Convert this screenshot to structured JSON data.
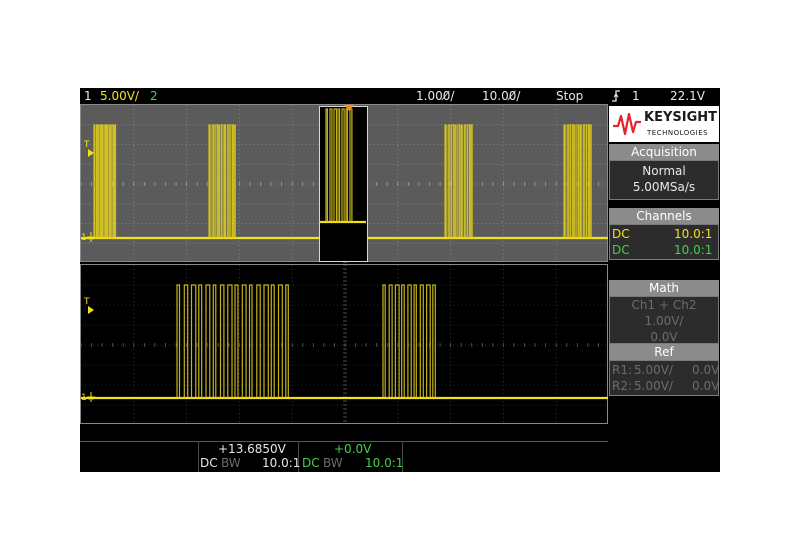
{
  "top_bar": {
    "ch1_num": "1",
    "ch1_scale": "5.00V/",
    "ch2_num": "2",
    "time_main": "1.000̸/",
    "time_zoom": "10.00̸/",
    "run_state": "Stop",
    "trigger_icon": "rising-edge-trigger-icon",
    "trigger_ch": "1",
    "trigger_level": "22.1V"
  },
  "logo": {
    "brand": "KEYSIGHT",
    "sub": "TECHNOLOGIES"
  },
  "acquisition": {
    "title": "Acquisition",
    "mode": "Normal",
    "rate": "5.00MSa/s"
  },
  "channels": {
    "title": "Channels",
    "rows": [
      {
        "coupling": "DC",
        "probe": "10.0:1"
      },
      {
        "coupling": "DC",
        "probe": "10.0:1"
      }
    ]
  },
  "math": {
    "title": "Math",
    "function": "Ch1 + Ch2",
    "scale": "1.00V/",
    "offset": "0.0V"
  },
  "ref": {
    "title": "Ref",
    "rows": [
      {
        "label": "R1:",
        "scale": "5.00V/",
        "offset": "0.0V"
      },
      {
        "label": "R2:",
        "scale": "5.00V/",
        "offset": "0.0V"
      }
    ]
  },
  "bottom": {
    "ch1": {
      "offset": "+13.6850V",
      "coupling": "DC",
      "bw": "BW",
      "probe": "10.0:1"
    },
    "ch2": {
      "offset": "+0.0V",
      "coupling": "DC",
      "bw": "BW",
      "probe": "10.0:1"
    }
  },
  "markers": {
    "trigger_marker": "T",
    "ground_marker": "1"
  },
  "colors": {
    "ch1": "#f2e21a",
    "ch2": "#43d14a",
    "trigger_marker": "#ff8a1a",
    "panel_gray": "#5b5b5b"
  }
}
